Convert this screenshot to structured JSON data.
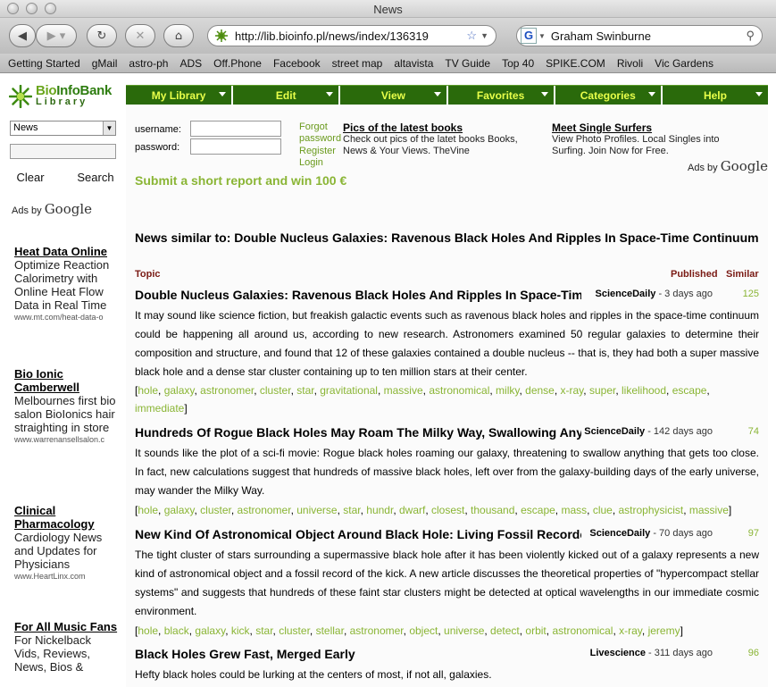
{
  "window": {
    "title": "News"
  },
  "toolbar": {
    "url": "http://lib.bioinfo.pl/news/index/136319",
    "search_value": "Graham Swinburne"
  },
  "bookmarks": [
    "Getting Started",
    "gMail",
    "astro-ph",
    "ADS",
    "Off.Phone",
    "Facebook",
    "street map",
    "altavista",
    "TV Guide",
    "Top 40",
    "SPIKE.COM",
    "Rivoli",
    "Vic Gardens"
  ],
  "logo": {
    "line1a": "Bio",
    "line1b": "InfoBank",
    "line2": "Library"
  },
  "menu": [
    "My Library",
    "Edit",
    "View",
    "Favorites",
    "Categories",
    "Help"
  ],
  "sidebar": {
    "select_value": "News",
    "clear_label": "Clear",
    "search_label": "Search",
    "ads_by": "Ads by",
    "google": "Google",
    "ads": [
      {
        "title": "Heat Data Online",
        "desc": "Optimize Reaction Calorimetry with Online Heat Flow Data in Real Time",
        "url": "www.mt.com/heat-data-o"
      },
      {
        "title": "Bio Ionic Camberwell",
        "desc": "Melbournes first bio salon BioIonics hair straighting in store",
        "url": "www.warrenansellsalon.c"
      },
      {
        "title": "Clinical Pharmacology",
        "desc": "Cardiology News and Updates for Physicians",
        "url": "www.HeartLinx.com"
      },
      {
        "title": "For All Music Fans",
        "desc": "For Nickelback Vids, Reviews, News, Bios &",
        "url": ""
      }
    ]
  },
  "login": {
    "username_label": "username:",
    "password_label": "password:",
    "forgot": "Forgot",
    "password_link": "password",
    "register": "Register",
    "login": "Login",
    "submit_report": "Submit a short report and win 100 €"
  },
  "top_ads": [
    {
      "title": "Pics of the latest books",
      "desc": "Check out pics of the latet books Books, News & Your Views. TheVine"
    },
    {
      "title": "Meet Single Surfers",
      "desc": "View Photo Profiles. Local Singles into Surfing. Join Now for Free."
    }
  ],
  "top_ads_by": "Ads by",
  "top_ads_google": "Google",
  "main": {
    "heading": "News similar to: Double Nucleus Galaxies: Ravenous Black Holes And Ripples In Space-Time Continuum",
    "col_topic": "Topic",
    "col_published": "Published",
    "col_similar": "Similar",
    "articles": [
      {
        "title": "Double Nucleus Galaxies: Ravenous Black Holes And Ripples In Space-Time Continuum",
        "source": "ScienceDaily",
        "age": " - 3 days ago",
        "similar": "125",
        "body": "It may sound like science fiction, but freakish galactic events such as ravenous black holes and ripples in the space-time continuum could be happening all around us, according to new research. Astronomers examined 50 regular galaxies to determine their composition and structure, and found that 12 of these galaxies contained a double nucleus -- that is, they had both a super massive black hole and a dense star cluster containing up to ten million stars at their center.",
        "tags": [
          "hole",
          "galaxy",
          "astronomer",
          "cluster",
          "star",
          "gravitational",
          "massive",
          "astronomical",
          "milky",
          "dense",
          "x-ray",
          "super",
          "likelihood",
          "escape",
          "immediate"
        ]
      },
      {
        "title": "Hundreds Of Rogue Black Holes May Roam The Milky Way, Swallowing Anything",
        "source": "ScienceDaily",
        "age": " - 142 days ago",
        "similar": "74",
        "body": "It sounds like the plot of a sci-fi movie: Rogue black holes roaming our galaxy, threatening to swallow anything that gets too close. In fact, new calculations suggest that hundreds of massive black holes, left over from the galaxy-building days of the early universe, may wander the Milky Way.",
        "tags": [
          "hole",
          "galaxy",
          "cluster",
          "astronomer",
          "universe",
          "star",
          "hundr",
          "dwarf",
          "closest",
          "thousand",
          "escape",
          "mass",
          "clue",
          "astrophysicist",
          "massive"
        ]
      },
      {
        "title": "New Kind Of Astronomical Object Around Black Hole: Living Fossil Recorded",
        "source": "ScienceDaily",
        "age": " - 70 days ago",
        "similar": "97",
        "body": "The tight cluster of stars surrounding a supermassive black hole after it has been violently kicked out of a galaxy represents a new kind of astronomical object and a fossil record of the kick. A new article discusses the theoretical properties of \"hypercompact stellar systems\" and suggests that hundreds of these faint star clusters might be detected at optical wavelengths in our immediate cosmic environment.",
        "tags": [
          "hole",
          "black",
          "galaxy",
          "kick",
          "star",
          "cluster",
          "stellar",
          "astronomer",
          "object",
          "universe",
          "detect",
          "orbit",
          "astronomical",
          "x-ray",
          "jeremy"
        ]
      },
      {
        "title": "Black Holes Grew Fast, Merged Early",
        "source": "Livescience",
        "age": " - 311 days ago",
        "similar": "96",
        "body": "Hefty black holes could be lurking at the centers of most, if not all, galaxies.",
        "tags": []
      }
    ]
  }
}
